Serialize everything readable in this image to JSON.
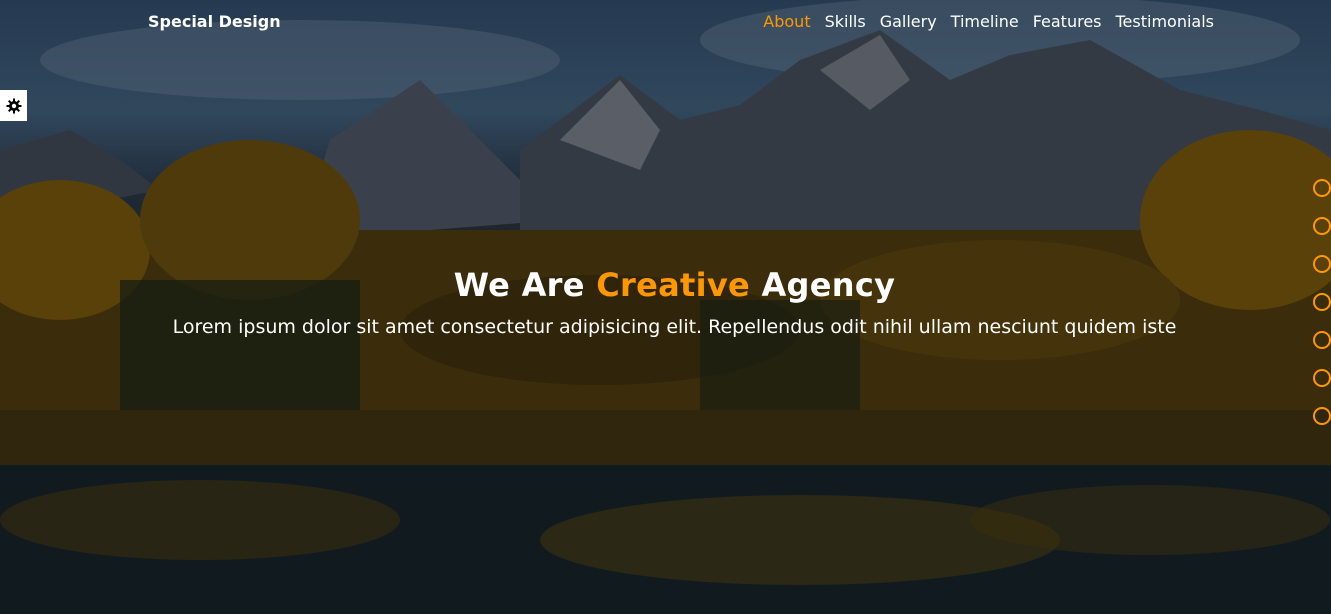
{
  "brand": {
    "logo": "Special Design",
    "accent_color": "#ff9800"
  },
  "nav": {
    "items": [
      {
        "label": "About",
        "active": true
      },
      {
        "label": "Skills",
        "active": false
      },
      {
        "label": "Gallery",
        "active": false
      },
      {
        "label": "Timeline",
        "active": false
      },
      {
        "label": "Features",
        "active": false
      },
      {
        "label": "Testimonials",
        "active": false
      }
    ]
  },
  "settings": {
    "icon": "gear-icon"
  },
  "intro": {
    "heading_start": "We Are",
    "heading_accent": "Creative",
    "heading_end": "Agency",
    "paragraph": "Lorem ipsum dolor sit amet consectetur adipisicing elit. Repellendus odit nihil ullam nesciunt quidem iste"
  },
  "nav_bullets": {
    "count": 7
  }
}
